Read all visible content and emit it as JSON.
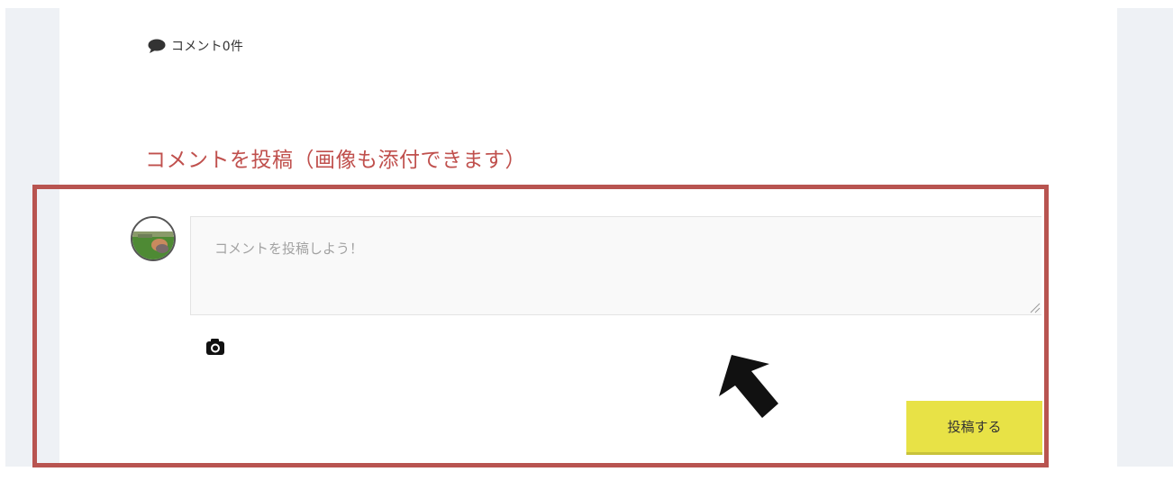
{
  "comments": {
    "count_label": "コメント0件",
    "icon": "speech-bubble-icon"
  },
  "form": {
    "heading": "コメントを投稿（画像も添付できます）",
    "textarea_placeholder": "コメントを投稿しよう！",
    "textarea_value": "",
    "attach_icon": "camera-icon",
    "submit_label": "投稿する"
  },
  "colors": {
    "heading": "#c0504d",
    "highlight_border": "#b85450",
    "submit_button": "#e8e246",
    "sidebar_bg": "#eef1f5"
  },
  "annotation": {
    "arrow_icon": "arrow-up-left-icon"
  }
}
